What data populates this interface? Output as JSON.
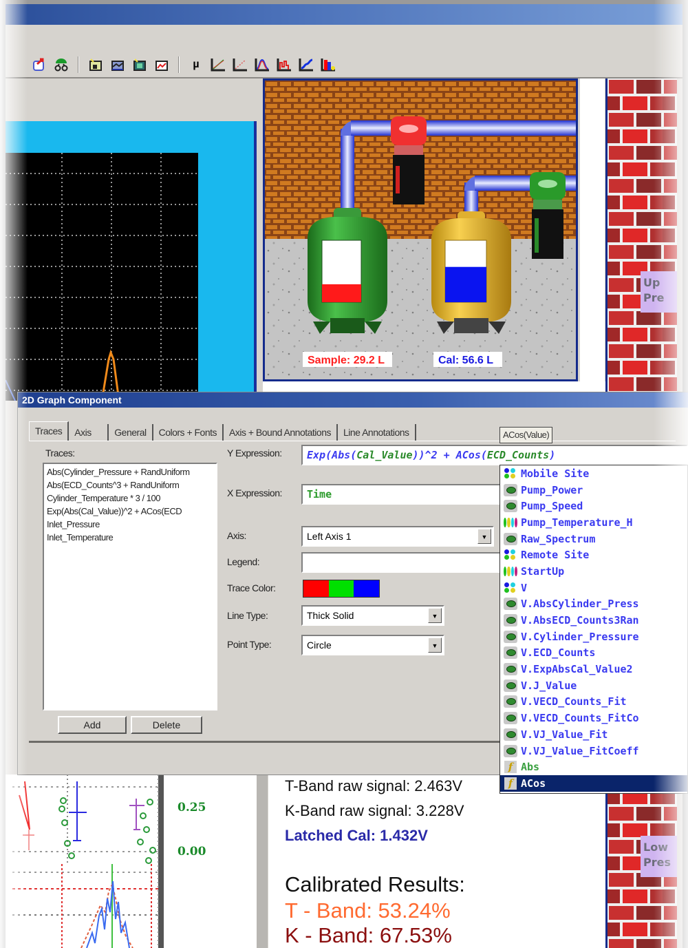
{
  "toolbar": {
    "icons": [
      "export-icon",
      "network-icon",
      "chart-wizard-icon",
      "chart-scene-icon",
      "chart-image-icon",
      "chart-line-icon",
      "mu-icon",
      "line-graph-icon",
      "line-graph-red-icon",
      "bell-curve-icon",
      "histogram-icon",
      "spline-icon",
      "bar-chart-icon"
    ],
    "mu_label": "µ"
  },
  "scene": {
    "sample_label": "Sample: 29.2 L",
    "cal_label": "Cal: 56.6 L",
    "sample_level": 0.29,
    "cal_level": 0.57,
    "colors": {
      "sample": "#ff1a1a",
      "cal": "#0a14f0",
      "pipe": "#5a6cf0"
    },
    "side_tags": [
      "Upper Pressure",
      "Lower Pressure"
    ],
    "side_tag_visible": [
      "Up\nPre",
      "Low\nPres"
    ]
  },
  "dialog": {
    "title": "2D Graph Component",
    "tabs": [
      "Traces",
      "Axis",
      "General",
      "Colors + Fonts",
      "Axis + Bound Annotations",
      "Line Annotations"
    ],
    "active_tab": "Traces",
    "tooltip": "ACos(Value)",
    "traces_label": "Traces:",
    "traces": [
      "Abs(Cylinder_Pressure + RandUniform",
      "Abs(ECD_Counts^3 + RandUniform",
      "Cylinder_Temperature * 3 / 100",
      "Exp(Abs(Cal_Value))^2 + ACos(ECD",
      "Inlet_Pressure",
      "Inlet_Temperature"
    ],
    "add_label": "Add",
    "delete_label": "Delete",
    "y_expression_label": "Y Expression:",
    "y_expression_parts": [
      {
        "t": "Exp(",
        "c": "#3a3af0"
      },
      {
        "t": "Abs(",
        "c": "#3a3af0"
      },
      {
        "t": "Cal_Value",
        "c": "#2a8a2a"
      },
      {
        "t": "))^2 + ",
        "c": "#3a3af0"
      },
      {
        "t": "ACos(",
        "c": "#3a3af0"
      },
      {
        "t": "ECD_Counts",
        "c": "#2a8a2a"
      },
      {
        "t": ")",
        "c": "#3a3af0"
      }
    ],
    "y_expression": "Exp(Abs(Cal_Value))^2 + ACos(ECD_Counts)",
    "x_expression_label": "X Expression:",
    "x_expression": "Time",
    "axis_label": "Axis:",
    "axis_value": "Left Axis 1",
    "legend_label": "Legend:",
    "legend_value": "",
    "trace_color_label": "Trace Color:",
    "trace_colors": [
      "#ff0000",
      "#00e000",
      "#0000ff"
    ],
    "line_type_label": "Line Type:",
    "line_type_value": "Thick Solid",
    "point_type_label": "Point Type:",
    "point_type_value": "Circle"
  },
  "autocomplete": {
    "items": [
      {
        "label": "Mobile Site",
        "icon": "site"
      },
      {
        "label": "Pump_Power",
        "icon": "var"
      },
      {
        "label": "Pump_Speed",
        "icon": "var"
      },
      {
        "label": "Pump_Temperature_H",
        "icon": "group"
      },
      {
        "label": "Raw_Spectrum",
        "icon": "var"
      },
      {
        "label": "Remote Site",
        "icon": "site"
      },
      {
        "label": "StartUp",
        "icon": "group"
      },
      {
        "label": "V",
        "icon": "site"
      },
      {
        "label": "V.AbsCylinder_Press",
        "icon": "var"
      },
      {
        "label": "V.AbsECD_Counts3Ran",
        "icon": "var"
      },
      {
        "label": "V.Cylinder_Pressure",
        "icon": "var"
      },
      {
        "label": "V.ECD_Counts",
        "icon": "var"
      },
      {
        "label": "V.ExpAbsCal_Value2",
        "icon": "var"
      },
      {
        "label": "V.J_Value",
        "icon": "var"
      },
      {
        "label": "V.VECD_Counts_Fit",
        "icon": "var"
      },
      {
        "label": "V.VECD_Counts_FitCo",
        "icon": "var"
      },
      {
        "label": "V.VJ_Value_Fit",
        "icon": "var"
      },
      {
        "label": "V.VJ_Value_FitCoeff",
        "icon": "var"
      },
      {
        "label": "Abs",
        "icon": "fn"
      },
      {
        "label": "ACos",
        "icon": "fn",
        "selected": true
      }
    ]
  },
  "bottom_chart": {
    "tick_labels": [
      "0.25",
      "0.00"
    ]
  },
  "readouts": {
    "t_band_raw": "T-Band raw signal: 2.463V",
    "k_band_raw": "K-Band raw signal: 3.228V",
    "latched_cal": "Latched Cal: 1.432V",
    "calibrated_heading": "Calibrated Results:",
    "t_band_result": "T - Band: 53.24%",
    "k_band_result": "K - Band: 67.53%",
    "colors": {
      "t_result": "#ff6a30",
      "k_result": "#8b0f0f",
      "latched": "#2a2aa8"
    }
  }
}
